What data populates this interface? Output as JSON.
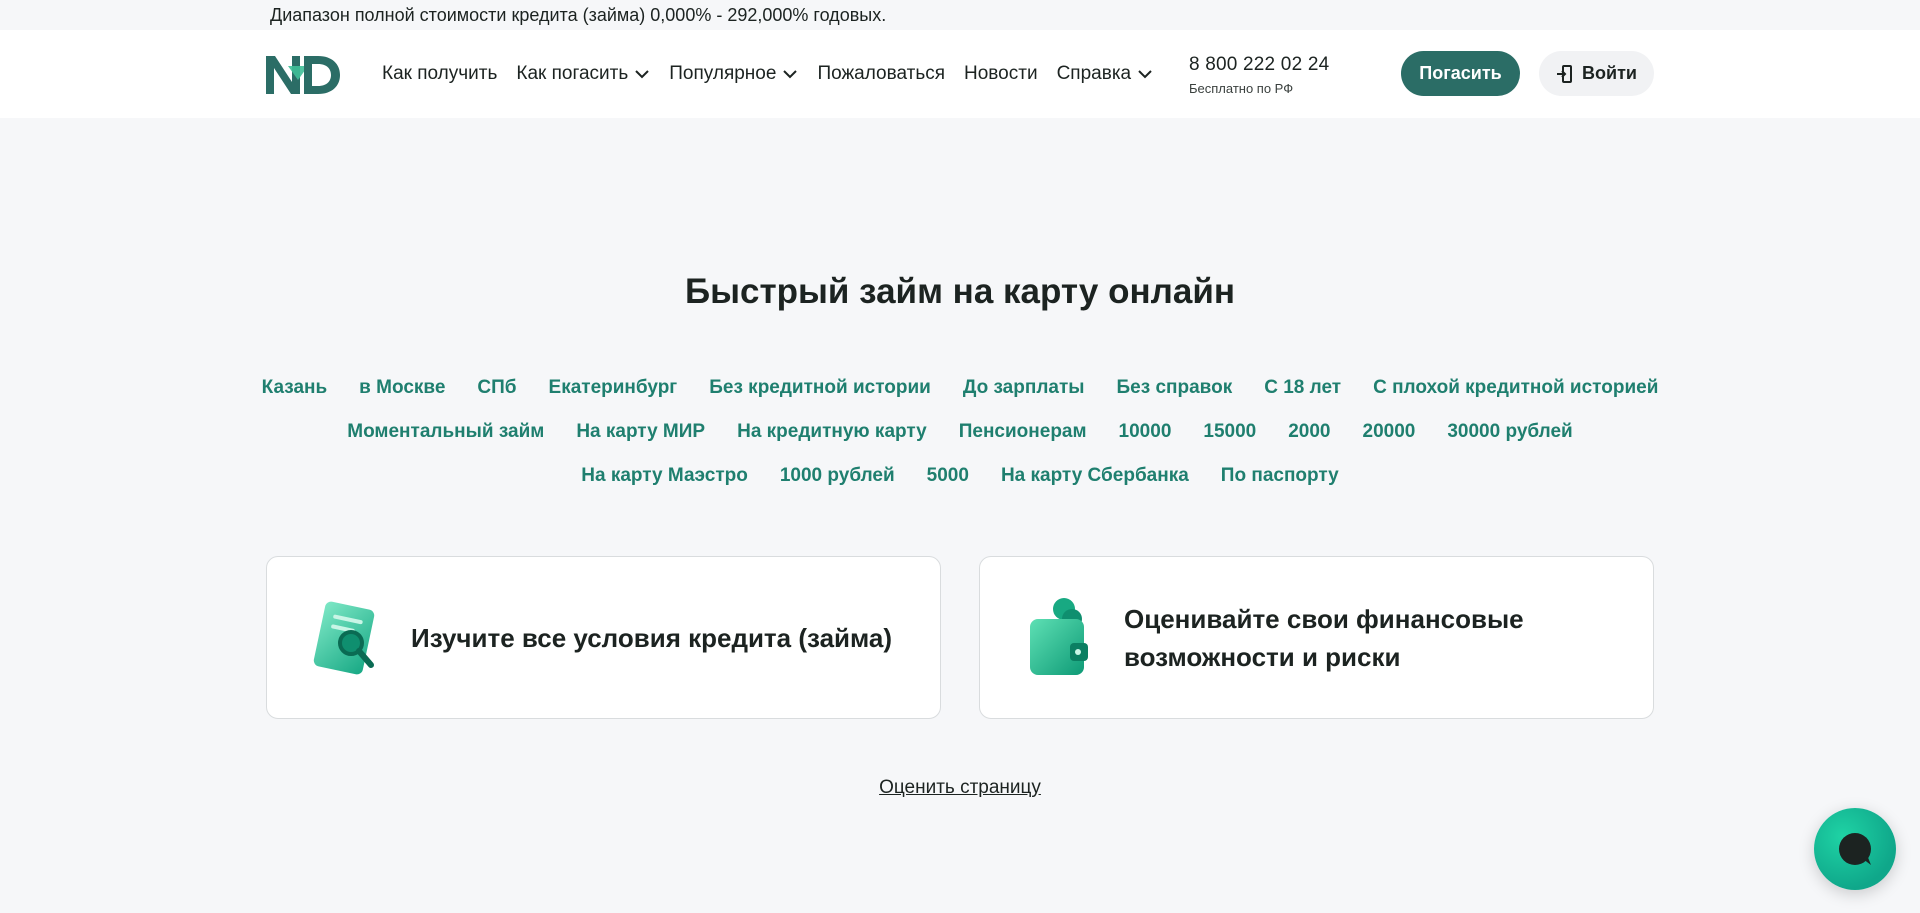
{
  "top_notice": "Диапазон полной стоимости кредита (займа) 0,000% - 292,000% годовых.",
  "header": {
    "logo_text": "ND",
    "nav": [
      {
        "label": "Как получить",
        "dropdown": false
      },
      {
        "label": "Как погасить",
        "dropdown": true
      },
      {
        "label": "Популярное",
        "dropdown": true
      },
      {
        "label": "Пожаловаться",
        "dropdown": false
      },
      {
        "label": "Новости",
        "dropdown": false
      },
      {
        "label": "Справка",
        "dropdown": true
      }
    ],
    "phone": "8 800 222 02 24",
    "phone_note": "Бесплатно по РФ",
    "pay_button": "Погасить",
    "login_button": "Войти"
  },
  "main": {
    "title": "Быстрый займ на карту онлайн",
    "tag_rows": [
      [
        "Казань",
        "в Москве",
        "СПб",
        "Екатеринбург",
        "Без кредитной истории",
        "До зарплаты",
        "Без справок",
        "С 18 лет",
        "С плохой кредитной историей"
      ],
      [
        "Моментальный займ",
        "На карту МИР",
        "На кредитную карту",
        "Пенсионерам",
        "10000",
        "15000",
        "2000",
        "20000",
        "30000 рублей"
      ],
      [
        "На карту Маэстро",
        "1000 рублей",
        "5000",
        "На карту Сбербанка",
        "По паспорту"
      ]
    ],
    "cards": [
      {
        "text": "Изучите все условия кредита (займа)",
        "icon": "document-magnifier-icon"
      },
      {
        "text": "Оценивайте свои финансовые возможности и риски",
        "icon": "wallet-coins-icon"
      }
    ],
    "rate_link": "Оценить страницу"
  },
  "colors": {
    "accent": "#2b6d66",
    "link": "#1f7f6f",
    "background": "#f6f7f9",
    "chat": "#10b894"
  }
}
